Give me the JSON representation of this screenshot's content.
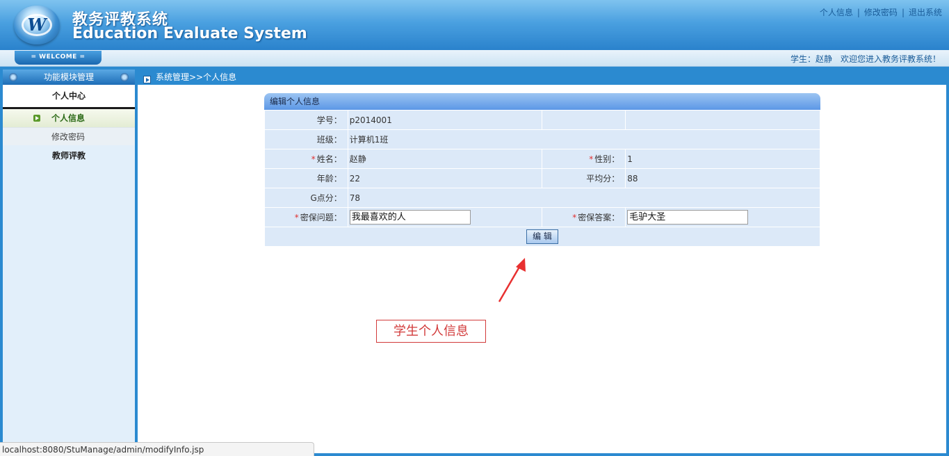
{
  "header": {
    "title_cn": "教务评教系统",
    "title_en": "Education Evaluate System",
    "logo_letter": "W",
    "links": [
      "个人信息",
      "修改密码",
      "退出系统"
    ],
    "link_sep": "|"
  },
  "subbar": {
    "welcome": "= WELCOME =",
    "user_label": "学生：赵静",
    "welcome_msg": "欢迎您进入教务评教系统！"
  },
  "sidebar": {
    "title": "功能模块管理",
    "group1": "个人中心",
    "items": [
      {
        "label": "个人信息",
        "active": true
      },
      {
        "label": "修改密码",
        "active": false
      }
    ],
    "group2": "教师评教"
  },
  "breadcrumb": "系统管理>>个人信息",
  "form": {
    "title": "编辑个人信息",
    "student_no_label": "学号：",
    "student_no": "p2014001",
    "class_label": "班级：",
    "class_value": "计算机1班",
    "name_label": "姓名：",
    "name_value": "赵静",
    "gender_label": "性别：",
    "gender_value": "1",
    "age_label": "年龄：",
    "age_value": "22",
    "avg_label": "平均分：",
    "avg_value": "88",
    "g_label": "G点分：",
    "g_value": "78",
    "question_label": "密保问题：",
    "question_value": "我最喜欢的人",
    "answer_label": "密保答案：",
    "answer_value": "毛驴大圣",
    "edit_button": "编 辑",
    "required_mark": "*"
  },
  "annotation": "学生个人信息",
  "statusbar": "localhost:8080/StuManage/admin/modifyInfo.jsp",
  "colors": {
    "header_blue": "#2a82cc",
    "form_row": "#dce9f8",
    "annotation_red": "#d23a3a"
  }
}
